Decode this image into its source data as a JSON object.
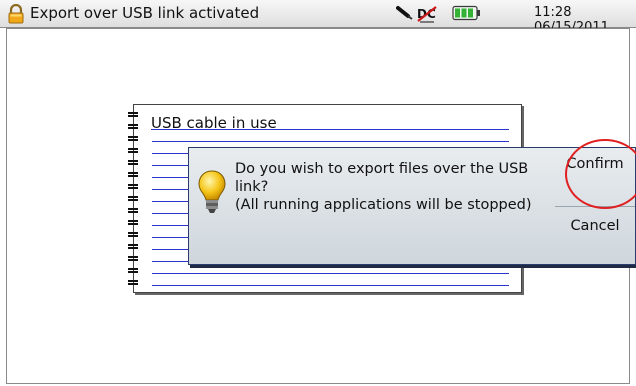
{
  "titlebar": {
    "title": "Export over USB link activated",
    "clock": "11:28 06/15/2011",
    "icons": [
      "lock-icon",
      "usb-plug-icon",
      "dc-power-icon",
      "battery-icon"
    ]
  },
  "notebook": {
    "title": "USB cable in use"
  },
  "dialog": {
    "message_lines": [
      "Do you wish to export files over the USB",
      "link?",
      "(All running applications will be stopped)"
    ],
    "confirm_label": "Confirm",
    "cancel_label": "Cancel"
  },
  "colors": {
    "line_blue": "#2b36c9",
    "highlight_red": "#e02020",
    "dialog_border": "#2a3d6a"
  }
}
